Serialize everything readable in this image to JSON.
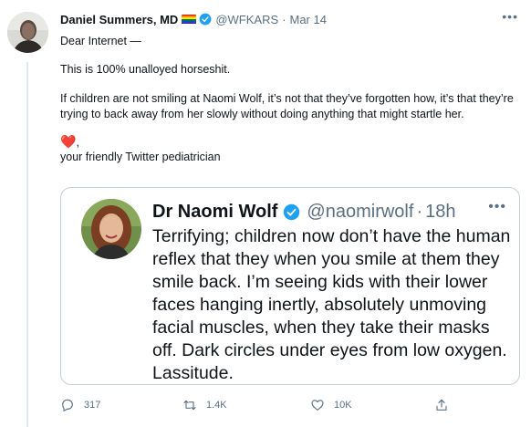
{
  "tweet": {
    "author": {
      "display_name": "Daniel Summers, MD",
      "handle": "@WFKARS",
      "separator": "·",
      "date": "Mar 14"
    },
    "lines": [
      "Dear Internet —",
      "This is 100% unalloyed horseshit.",
      "If children are not smiling at Naomi Wolf, it’s not that they’ve forgotten how, it’s that they’re trying to back away from her slowly without doing anything that might startle her.",
      ",",
      "your friendly Twitter pediatrician"
    ],
    "heart_emoji": "❤️",
    "more_label": "•••"
  },
  "quoted_tweet": {
    "display_name": "Dr Naomi Wolf",
    "handle": "@naomirwolf",
    "separator": "·",
    "date": "18h",
    "more_label": "•••",
    "text": "Terrifying; children now don’t have the human reflex that they when you smile at them they smile back. I’m seeing kids with their lower faces hanging inertly, absolutely unmoving facial muscles, when they take their masks off. Dark circles under eyes from low oxygen. Lassitude."
  },
  "actions": {
    "reply_count": "317",
    "retweet_count": "1.4K",
    "like_count": "10K"
  },
  "colors": {
    "verified_blue": "#1da1f2",
    "secondary_text": "#5b7083",
    "heart_red": "#e0245e",
    "border": "#c4cfd6"
  },
  "icons": [
    "rainbow-flag-icon",
    "verified-badge-icon",
    "reply-icon",
    "retweet-icon",
    "like-icon",
    "share-icon",
    "more-icon"
  ]
}
